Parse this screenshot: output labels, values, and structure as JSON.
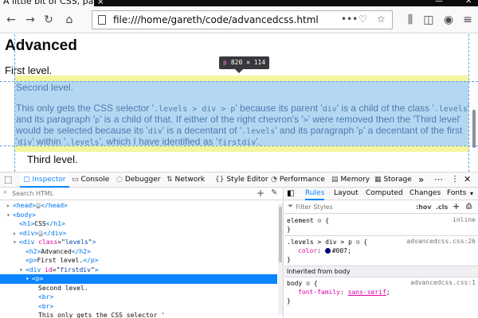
{
  "tab": {
    "title": "A little bit of CSS, part two",
    "close": "×"
  },
  "window": {
    "minimize": "—",
    "close": "✕"
  },
  "nav": {
    "url": "file:///home/gareth/code/advancedcss.html"
  },
  "page": {
    "heading": "Advanced",
    "first_level": "First level.",
    "second_level": "Second level.",
    "para_parts": [
      "This only gets the CSS selector '",
      ".levels > div > p",
      "' because its parent '",
      "div",
      "' is a child of the class '",
      ".levels",
      "' and its paragraph '",
      "p",
      "' is a child of that. If either of the right chevron's '",
      ">",
      "' were removed then the 'Third level' would be selected because its '",
      "div",
      "' is a decentant of '",
      ".levels",
      "' and its paragraph '",
      "p",
      "' a decentant of the first '",
      "div",
      "' within '",
      ".levels",
      "', which I have identified as '",
      "firstdiv",
      "'."
    ],
    "third_level": "Third level.",
    "tooltip_tag": "p",
    "tooltip_dims": "820 × 114"
  },
  "devtools": {
    "tabs": [
      "Inspector",
      "Console",
      "Debugger",
      "Network",
      "Style Editor",
      "Performance",
      "Memory",
      "Storage"
    ],
    "more": "»",
    "search_placeholder": "Search HTML",
    "tree": [
      {
        "indent": 1,
        "tw": "▸",
        "open": "<head>",
        "ellip": "…",
        "close": "</head>"
      },
      {
        "indent": 1,
        "tw": "▾",
        "open": "<body>"
      },
      {
        "indent": 2,
        "tw": "",
        "open": "<h1>",
        "text": "CSS",
        "close": "</h1>"
      },
      {
        "indent": 2,
        "tw": "▸",
        "open": "<div>",
        "ellip": "…",
        "close": "</div>"
      },
      {
        "indent": 2,
        "tw": "▾",
        "tagname": "div",
        "attr": "class",
        "val": "levels"
      },
      {
        "indent": 3,
        "tw": "",
        "open": "<h2>",
        "text": "Advanced",
        "close": "</h2>"
      },
      {
        "indent": 3,
        "tw": "",
        "open": "<p>",
        "text": "First level.",
        "close": "</p>"
      },
      {
        "indent": 3,
        "tw": "▾",
        "tagname": "div",
        "attr": "id",
        "val": "firstdiv"
      },
      {
        "indent": 4,
        "tw": "▾",
        "open": "<p>",
        "selected": true
      },
      {
        "indent": 5,
        "tw": "",
        "text": "Second level."
      },
      {
        "indent": 5,
        "tw": "",
        "open": "<br>"
      },
      {
        "indent": 5,
        "tw": "",
        "open": "<br>"
      },
      {
        "indent": 5,
        "tw": "",
        "text": "This only gets the CSS selector '"
      }
    ],
    "right_tabs": [
      "Rules",
      "Layout",
      "Computed",
      "Changes",
      "Fonts"
    ],
    "filter_placeholder": "Filter Styles",
    "filter_opts": [
      ":hov",
      ".cls"
    ],
    "rules": [
      {
        "selector": "element",
        "source": "inline",
        "props": []
      },
      {
        "selector": ".levels > div > p",
        "source": "advancedcss.css:26",
        "props": [
          {
            "name": "color",
            "value": "#007",
            "swatch": "#000077"
          }
        ]
      }
    ],
    "inherited_header": "Inherited from body",
    "inherited_rule": {
      "selector": "body",
      "source": "advancedcss.css:1",
      "prop": "font-family",
      "value": "sans-serif"
    }
  }
}
